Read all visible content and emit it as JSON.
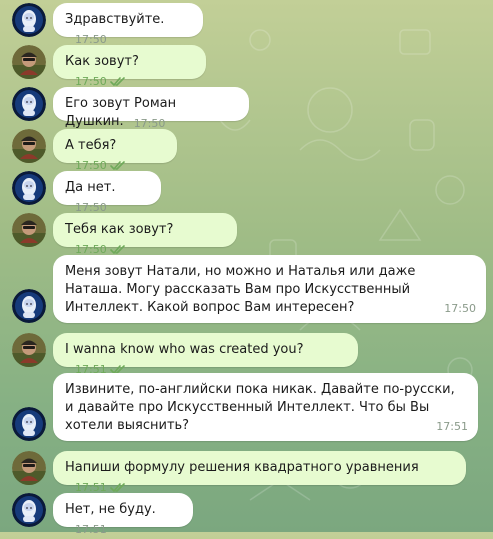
{
  "messages": [
    {
      "side": "in",
      "avatar": "robot-avatar",
      "text": "Здравствуйте.",
      "time": "17:50",
      "read": false
    },
    {
      "side": "out",
      "avatar": "user-avatar",
      "text": "Как зовут?",
      "time": "17:50",
      "read": true
    },
    {
      "side": "in",
      "avatar": "robot-avatar",
      "text": "Его зовут Роман Душкин.",
      "time": "17:50",
      "read": false
    },
    {
      "side": "out",
      "avatar": "user-avatar",
      "text": "А тебя?",
      "time": "17:50",
      "read": true
    },
    {
      "side": "in",
      "avatar": "robot-avatar",
      "text": "Да нет.",
      "time": "17:50",
      "read": false
    },
    {
      "side": "out",
      "avatar": "user-avatar",
      "text": "Тебя как зовут?",
      "time": "17:50",
      "read": true
    },
    {
      "side": "in",
      "avatar": "robot-avatar",
      "text": "Меня зовут Натали, но можно и Наталья или даже Наташа. Могу рассказать Вам про Искусственный Интеллект. Какой вопрос Вам интересен?",
      "time": "17:50",
      "read": false
    },
    {
      "side": "out",
      "avatar": "user-avatar",
      "text": "I wanna know who was created you?",
      "time": "17:51",
      "read": true
    },
    {
      "side": "in",
      "avatar": "robot-avatar",
      "text": "Извините, по-английски пока никак. Давайте по-русски, и давайте про Искусственный Интеллект. Что бы Вы хотели выяснить?",
      "time": "17:51",
      "read": false
    },
    {
      "side": "out",
      "avatar": "user-avatar",
      "text": "Напиши формулу решения квадратного уравнения",
      "time": "17:51",
      "read": true
    },
    {
      "side": "in",
      "avatar": "robot-avatar",
      "text": "Нет, не буду.",
      "time": "17:51",
      "read": false
    }
  ],
  "colors": {
    "incoming_bubble": "#ffffff",
    "outgoing_bubble": "#e7fbd0",
    "read_check": "#6faa5a",
    "time_text": "#8a9a8a"
  },
  "icons": {
    "read_receipt": "double-check-icon"
  }
}
